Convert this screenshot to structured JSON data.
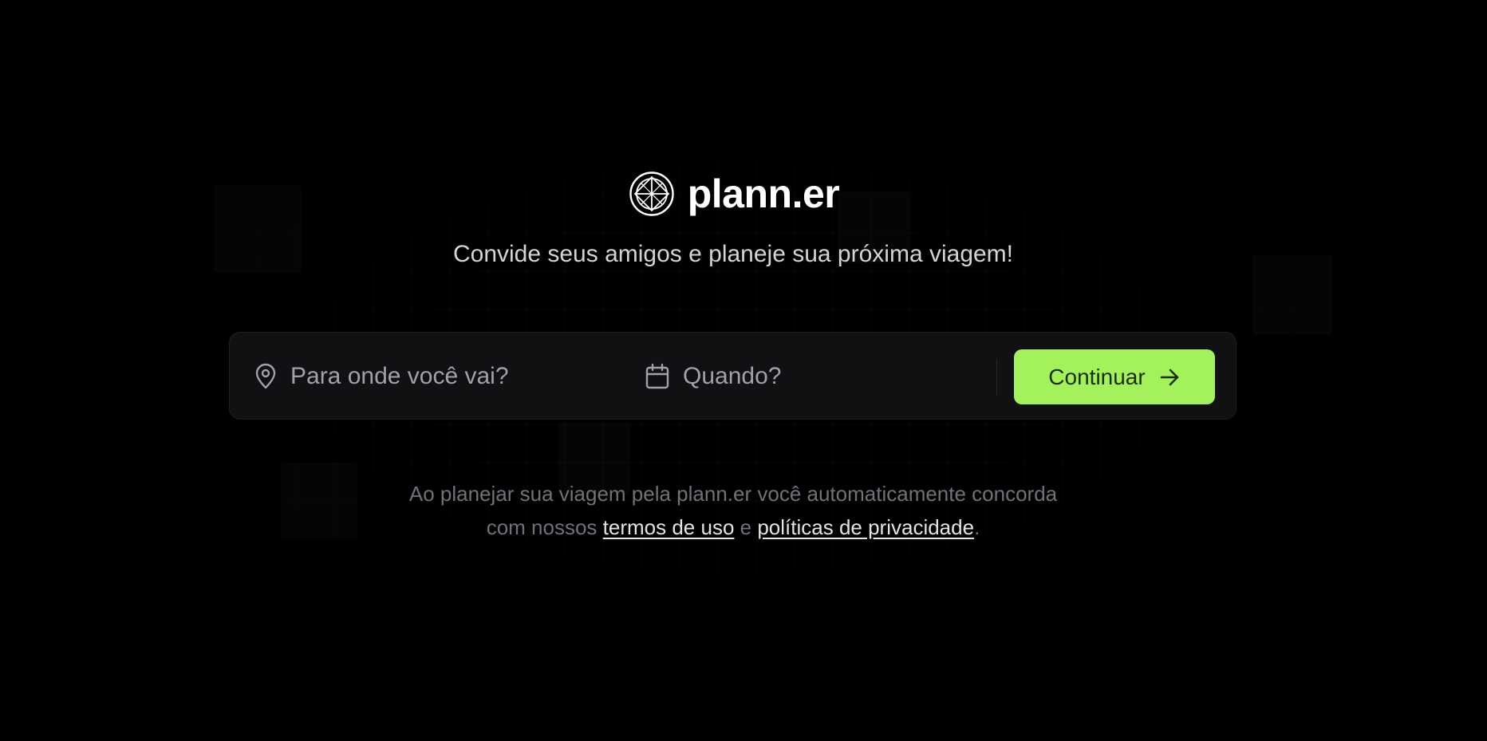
{
  "brand": {
    "logo_icon": "globe-logo-icon",
    "name": "plann.er"
  },
  "tagline": "Convide seus amigos e planeje sua próxima viagem!",
  "search": {
    "destination": {
      "icon": "map-pin-icon",
      "placeholder": "Para onde você vai?"
    },
    "date": {
      "icon": "calendar-icon",
      "placeholder": "Quando?"
    },
    "continue_button": {
      "label": "Continuar",
      "icon": "arrow-right-icon"
    }
  },
  "legal": {
    "line1": "Ao planejar sua viagem pela plann.er você automaticamente concorda",
    "line2_prefix": "com nossos",
    "terms_link": "termos de uso",
    "conjunction": "e",
    "privacy_link": "políticas de privacidade",
    "suffix": "."
  },
  "colors": {
    "background": "#000000",
    "accent": "#a3f25b",
    "input_bg": "#111113",
    "muted_text": "#71717a"
  }
}
